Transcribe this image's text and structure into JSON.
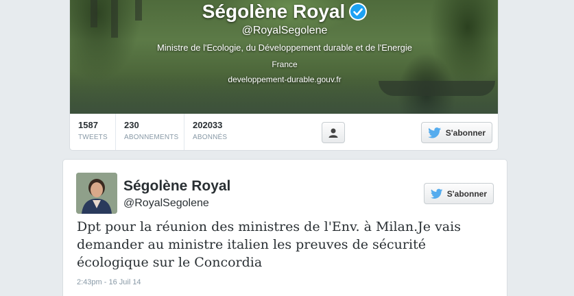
{
  "profile": {
    "name": "Ségolène Royal",
    "handle": "@RoyalSegolene",
    "bio": "Ministre de l'Ecologie, du Développement durable et de l'Energie",
    "location": "France",
    "url": "developpement-durable.gouv.fr",
    "verified": true
  },
  "stats": [
    {
      "value": "1587",
      "label": "TWEETS"
    },
    {
      "value": "230",
      "label": "ABONNEMENTS"
    },
    {
      "value": "202033",
      "label": "ABONNÉS"
    }
  ],
  "buttons": {
    "follow_label": "S'abonner"
  },
  "tweet": {
    "author_name": "Ségolène Royal",
    "author_handle": "@RoyalSegolene",
    "text": "Dpt pour la réunion des ministres de l'Env. à Milan.Je vais demander au ministre italien les preuves de sécurité écologique sur le Concordia",
    "timestamp": "2:43pm - 16 Juil 14"
  },
  "colors": {
    "twitter_blue": "#55acee",
    "verified_blue": "#1da1f2",
    "page_bg": "#e7ebee"
  }
}
